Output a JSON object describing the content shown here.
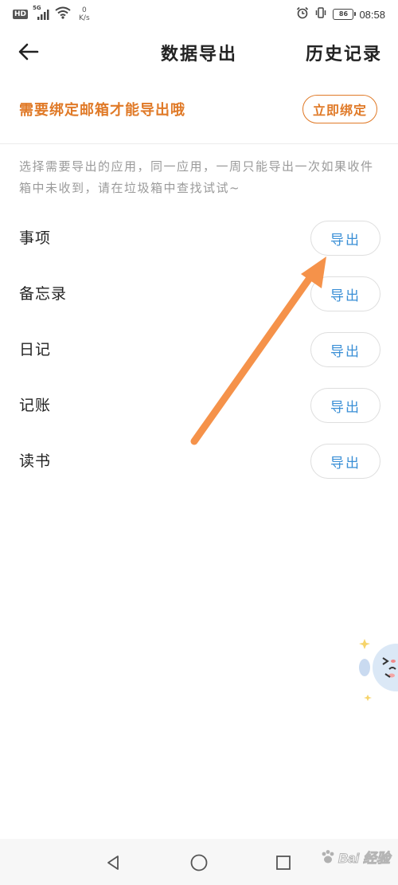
{
  "status_bar": {
    "hd": "HD",
    "signal_gen": "5G",
    "net_speed_value": "0",
    "net_speed_unit": "K/s",
    "battery": "86",
    "time": "08:58",
    "icons": [
      "signal-icon",
      "wifi-icon",
      "alarm-icon",
      "vibrate-icon",
      "battery-icon"
    ]
  },
  "header": {
    "title": "数据导出",
    "history": "历史记录",
    "back_icon": "arrow-left-icon"
  },
  "email_banner": {
    "hint": "需要绑定邮箱才能导出哦",
    "bind_button": "立即绑定",
    "accent_color": "#e07a28"
  },
  "description": "选择需要导出的应用，同一应用，一周只能导出一次如果收件箱中未收到，请在垃圾箱中查找试试~",
  "apps": [
    {
      "name": "事项",
      "action": "导出"
    },
    {
      "name": "备忘录",
      "action": "导出"
    },
    {
      "name": "日记",
      "action": "导出"
    },
    {
      "name": "记账",
      "action": "导出"
    },
    {
      "name": "读书",
      "action": "导出"
    }
  ],
  "export_button_color": "#3a8fd6",
  "annotation": {
    "arrow_color": "#f5924a",
    "icon": "arrow-annotation-icon"
  },
  "nav_bar": {
    "icons": [
      "back-triangle-icon",
      "home-circle-icon",
      "recents-square-icon"
    ]
  },
  "watermark": {
    "text": "Bai  经验",
    "icon": "paw-icon"
  }
}
